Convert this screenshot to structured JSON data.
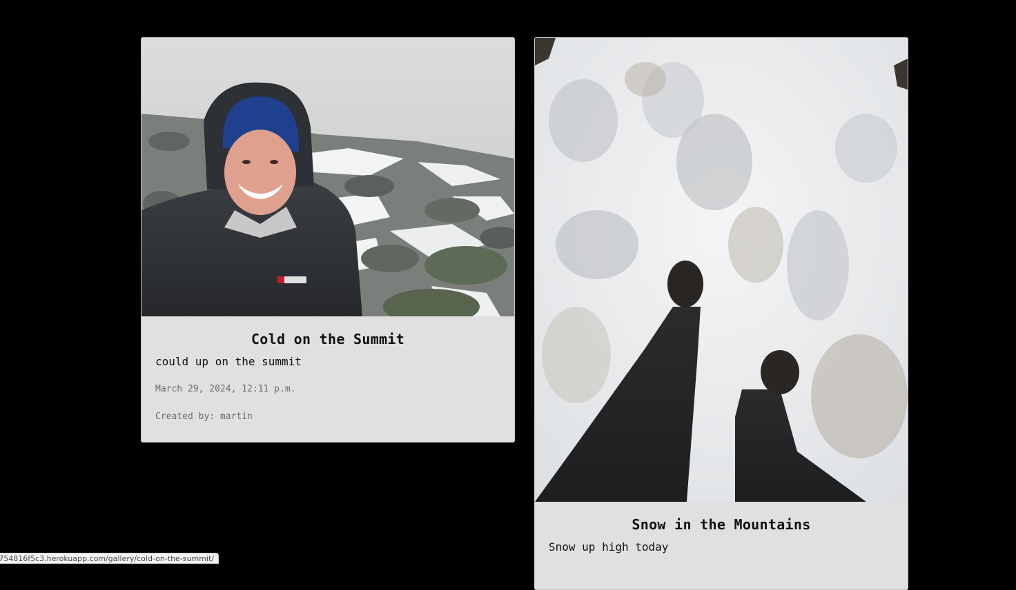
{
  "gallery": {
    "cards": [
      {
        "title": "Cold on the Summit",
        "description": "could up on the summit",
        "date": "March 29, 2024, 12:11 p.m.",
        "author": "Created by: martin"
      },
      {
        "title": "Snow in the Mountains",
        "description": "Snow up high today"
      }
    ]
  },
  "status_bar": {
    "url": "754816f5c3.herokuapp.com/gallery/cold-on-the-summit/"
  },
  "colors": {
    "page_background": "#000000",
    "card_background": "#e0e0e0",
    "meta_text": "#6c6c6c"
  }
}
